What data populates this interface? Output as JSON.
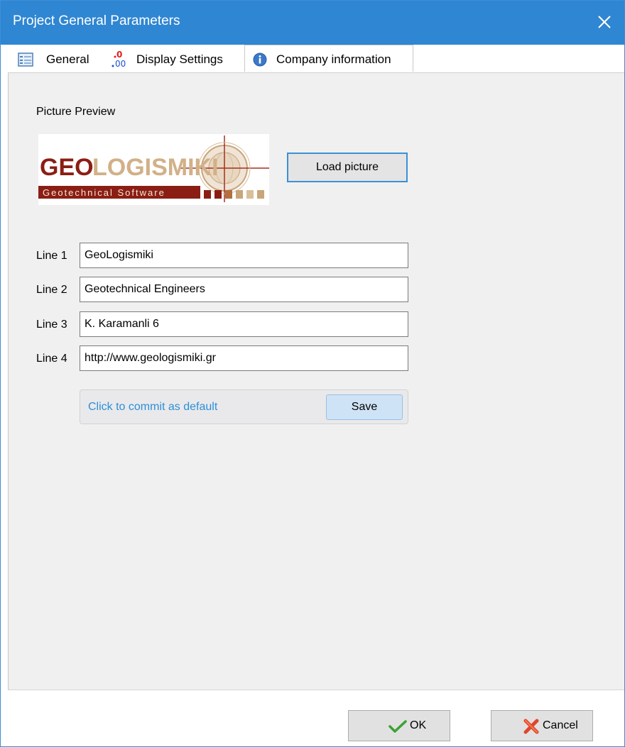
{
  "window": {
    "title": "Project General Parameters"
  },
  "tabs": [
    {
      "label": "General",
      "icon": "form-icon"
    },
    {
      "label": "Display Settings",
      "icon": "decimal-icon"
    },
    {
      "label": "Company information",
      "icon": "info-icon",
      "active": true
    }
  ],
  "company": {
    "preview_label": "Picture Preview",
    "logo": {
      "brand": "GEOLOGISMIKI",
      "brand_prefix": "GEO",
      "brand_suffix": "LOGISMIKI",
      "tagline": "Geotechnical Software"
    },
    "load_button": "Load picture",
    "lines": [
      {
        "label": "Line 1",
        "value": "GeoLogismiki"
      },
      {
        "label": "Line 2",
        "value": "Geotechnical Engineers"
      },
      {
        "label": "Line 3",
        "value": "K. Karamanli 6"
      },
      {
        "label": "Line 4",
        "value": "http://www.geologismiki.gr"
      }
    ],
    "commit_text": "Click to commit as default",
    "save_button": "Save"
  },
  "footer": {
    "ok_label": "OK",
    "cancel_label": "Cancel"
  },
  "colors": {
    "titlebar": "#2f86d2",
    "accent": "#3d8fd6",
    "link": "#2c8fd6",
    "logo_red": "#8b1e14",
    "logo_tan": "#c9a57a"
  }
}
